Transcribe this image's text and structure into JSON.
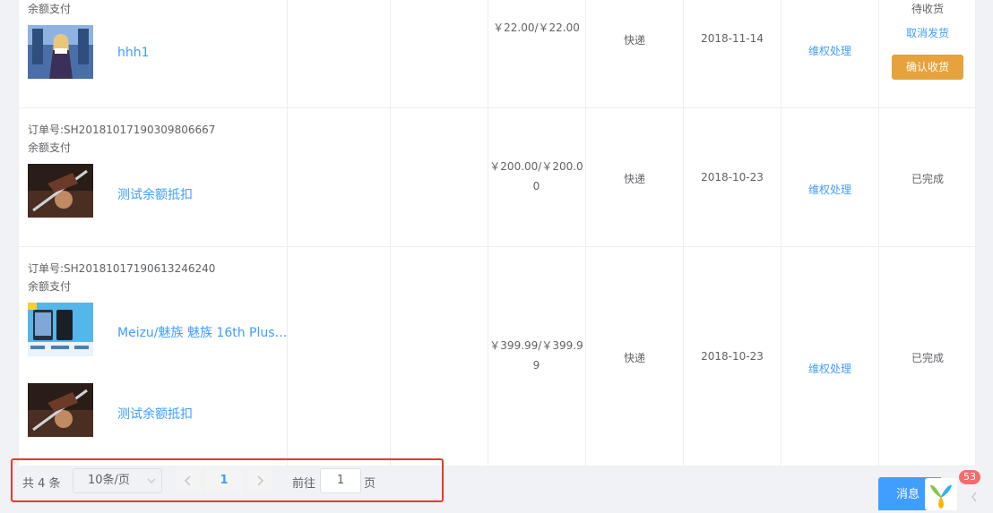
{
  "orders": [
    {
      "order_no": "",
      "payment": "余额支付",
      "products": [
        {
          "name": "hhh1",
          "image": "anime-girl-thumbnail"
        }
      ],
      "price": "￥22.00/￥22.00",
      "shipping": "快递",
      "date": "2018-11-14",
      "rights": "维权处理",
      "status": "待收货",
      "cancel_link": "取消发货",
      "confirm_button": "确认收货"
    },
    {
      "order_no": "订单号:SH20181017190309806667",
      "payment": "余额支付",
      "products": [
        {
          "name": "测试余额抵扣",
          "image": "anime-sword-thumbnail"
        }
      ],
      "price": "￥200.00/￥200.00",
      "shipping": "快递",
      "date": "2018-10-23",
      "rights": "维权处理",
      "status": "已完成"
    },
    {
      "order_no": "订单号:SH20181017190613246240",
      "payment": "余额支付",
      "products": [
        {
          "name": "Meizu/魅族 魅族 16th Plus ...",
          "image": "phone-thumbnail"
        },
        {
          "name": "测试余额抵扣",
          "image": "anime-sword-thumbnail"
        }
      ],
      "price": "￥399.99/￥399.99",
      "shipping": "快递",
      "date": "2018-10-23",
      "rights": "维权处理",
      "status": "已完成"
    }
  ],
  "pagination": {
    "total": "共 4 条",
    "page_size": "10条/页",
    "prev_icon": "chevron-left-icon",
    "current_page": "1",
    "next_icon": "chevron-right-icon",
    "goto_label": "前往",
    "goto_value": "1",
    "goto_suffix": "页"
  },
  "widgets": {
    "message_button": "消息",
    "badge_count": "53",
    "collapse_icon": "chevron-left-icon"
  },
  "colors": {
    "link": "#409eff",
    "confirm": "#e6a23c",
    "badge": "#f56c6c",
    "highlight": "#e53935"
  }
}
